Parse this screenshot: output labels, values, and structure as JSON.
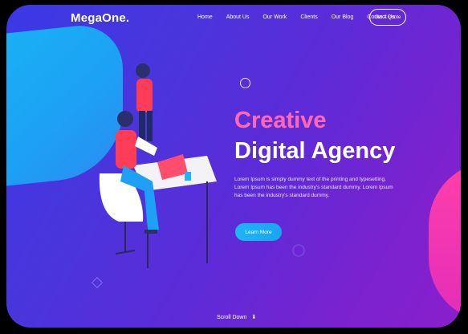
{
  "brand": {
    "name": "MegaOne."
  },
  "nav": {
    "items": [
      "Home",
      "About Us",
      "Our Work",
      "Clients",
      "Our Blog",
      "Contact Us"
    ],
    "cta": "Get A Quote"
  },
  "hero": {
    "title_line1": "Creative",
    "title_line2": "Digital Agency",
    "description": "Lorem Ipsum is simply dummy text of the printing and typesetting. Lorem Ipsum has been the industry's standard dummy. Lorem Ipsum has been the industry's standard dummy.",
    "button": "Learn More"
  },
  "footer_hint": {
    "scroll_label": "Scroll Down",
    "arrow": "⬇"
  },
  "colors": {
    "gradient_start": "#3a39e6",
    "gradient_end": "#8a1fcc",
    "accent_blue": "#1da0f5",
    "accent_pink": "#ff3fa8",
    "headline_pink": "#ff67b2"
  }
}
